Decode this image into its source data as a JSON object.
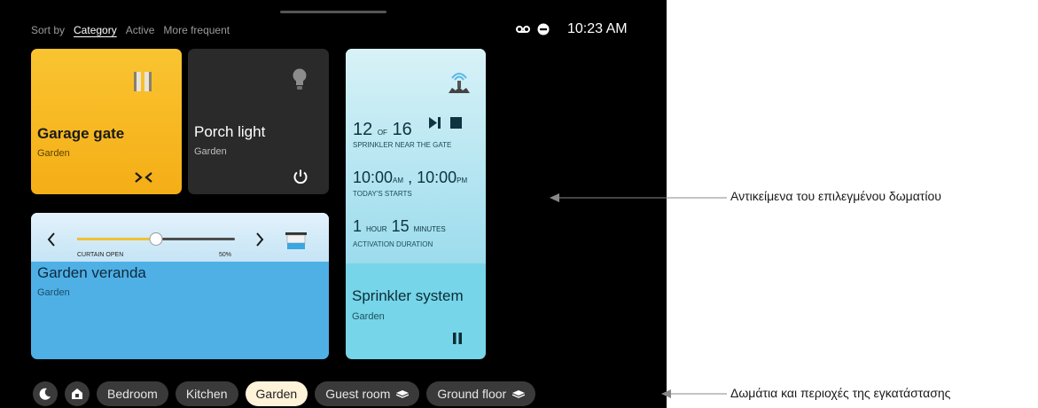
{
  "sort": {
    "label": "Sort by",
    "options": [
      "Category",
      "Active",
      "More frequent"
    ],
    "selected": "Category"
  },
  "status": {
    "time": "10:23 AM",
    "icons": [
      "voicemail-icon",
      "do-not-disturb-icon"
    ]
  },
  "cards": {
    "garage": {
      "title": "Garage gate",
      "room": "Garden",
      "icon": "gate-icon",
      "action_icon": "close-arrows-icon"
    },
    "porch": {
      "title": "Porch light",
      "room": "Garden",
      "icon": "bulb-icon",
      "action_icon": "power-icon"
    },
    "veranda": {
      "title": "Garden veranda",
      "room": "Garden",
      "slider_label": "CURTAIN OPEN",
      "slider_value": "50%",
      "level": 0.5,
      "icon": "curtain-icon"
    },
    "sprinkler": {
      "title": "Sprinkler system",
      "room": "Garden",
      "icon": "sprinkler-icon",
      "count_current": "12",
      "count_of": "OF",
      "count_total": "16",
      "zone": "SPRINKLER NEAR THE GATE",
      "start1": "10:00",
      "start1_unit": "AM",
      "start_sep": ",",
      "start2": "10:00",
      "start2_unit": "PM",
      "starts_label": "TODAY'S STARTS",
      "dur_h": "1",
      "dur_h_unit": "HOUR",
      "dur_m": "15",
      "dur_m_unit": "MINUTES",
      "dur_label": "ACTIVATION DURATION"
    }
  },
  "rooms": {
    "items": [
      "Bedroom",
      "Kitchen",
      "Garden",
      "Guest room",
      "Ground floor"
    ],
    "selected": "Garden"
  },
  "callouts": {
    "objects": "Αντικείμενα του επιλεγμένου δωματίου",
    "rooms": "Δωμάτια και περιοχές της εγκατάστασης"
  },
  "colors": {
    "garage": "#f7b91f",
    "veranda": "#4fb0e6",
    "sprinkler": "#76d5e8",
    "slider": "#f1c232"
  }
}
